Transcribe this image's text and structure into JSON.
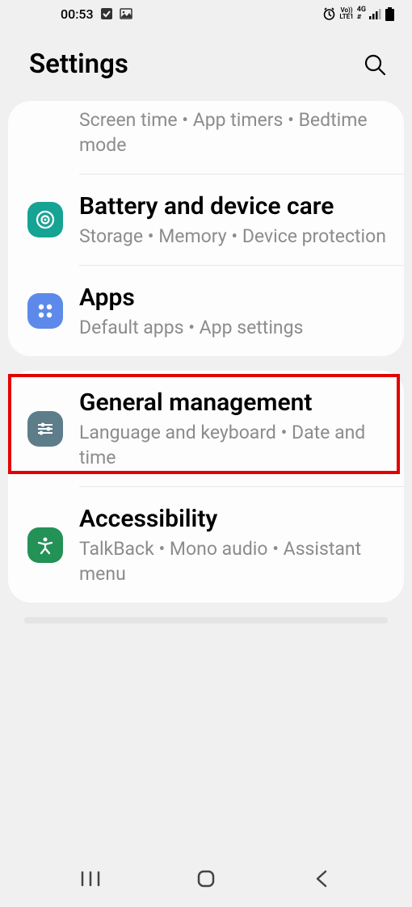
{
  "status": {
    "time": "00:53",
    "network": "LTE1",
    "voice": "Vo))",
    "data": "4G"
  },
  "header": {
    "title": "Settings"
  },
  "card1": {
    "item0": {
      "subtitle": "Screen time  •  App timers  •  Bedtime mode"
    },
    "item1": {
      "title": "Battery and device care",
      "subtitle": "Storage  •  Memory  •  Device protection"
    },
    "item2": {
      "title": "Apps",
      "subtitle": "Default apps  •  App settings"
    }
  },
  "card2": {
    "item0": {
      "title": "General management",
      "subtitle": "Language and keyboard  •  Date and time"
    },
    "item1": {
      "title": "Accessibility",
      "subtitle": "TalkBack  •  Mono audio  •  Assistant menu"
    }
  }
}
